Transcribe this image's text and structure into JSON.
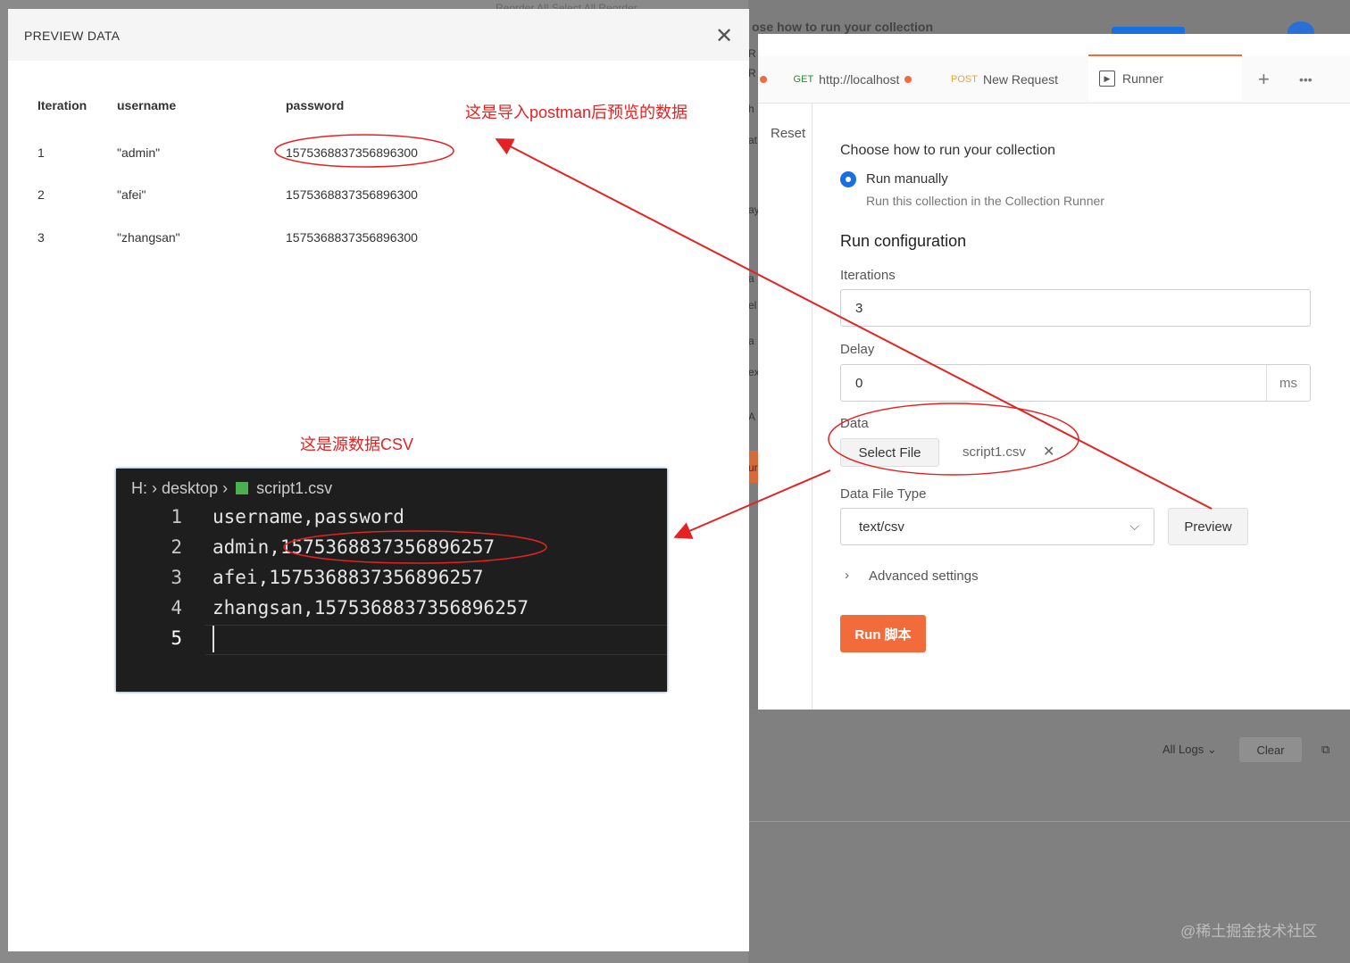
{
  "background": {
    "top_heading": "ose how to run your collection",
    "top_menu": "Reorder All  Select All  Reorder",
    "logs_filter": "All Logs",
    "clear_label": "Clear",
    "side_letters": [
      "R",
      "R",
      "h",
      "at",
      "ay",
      "a",
      "el",
      "a",
      "ex",
      "A",
      "ur"
    ]
  },
  "runner": {
    "tabs": [
      {
        "method": "GET",
        "label": "http://localhost"
      },
      {
        "method": "POST",
        "label": "New Request"
      },
      {
        "label": "Runner"
      }
    ],
    "reset_label": "Reset",
    "choose_heading": "Choose how to run your collection",
    "run_manually_label": "Run manually",
    "run_manually_desc": "Run this collection in the Collection Runner",
    "run_config_heading": "Run configuration",
    "iterations_label": "Iterations",
    "iterations_value": "3",
    "delay_label": "Delay",
    "delay_value": "0",
    "delay_unit": "ms",
    "data_label": "Data",
    "select_file_label": "Select File",
    "file_name": "script1.csv",
    "data_file_type_label": "Data File Type",
    "data_file_type_value": "text/csv",
    "preview_label": "Preview",
    "advanced_label": "Advanced settings",
    "run_button_label": "Run 脚本"
  },
  "preview_modal": {
    "title": "PREVIEW DATA",
    "columns": [
      "Iteration",
      "username",
      "password"
    ],
    "rows": [
      [
        "1",
        "\"admin\"",
        "1575368837356896300"
      ],
      [
        "2",
        "\"afei\"",
        "1575368837356896300"
      ],
      [
        "3",
        "\"zhangsan\"",
        "1575368837356896300"
      ]
    ]
  },
  "editor": {
    "crumb_drive": "H:",
    "crumb_folder": "desktop",
    "crumb_file": "script1.csv",
    "line_numbers": [
      "1",
      "2",
      "3",
      "4",
      "5"
    ],
    "lines": [
      "username,password",
      "admin,1575368837356896257",
      "afei,1575368837356896257",
      "zhangsan,1575368837356896257",
      ""
    ]
  },
  "annotations": {
    "preview_note": "这是导入postman后预览的数据",
    "source_note": "这是源数据CSV",
    "color": "#e52222"
  },
  "watermark": "@稀土掘金技术社区",
  "colors": {
    "accent": "#f26b3a",
    "radio": "#1a6fe0",
    "annotation": "#e52222"
  }
}
